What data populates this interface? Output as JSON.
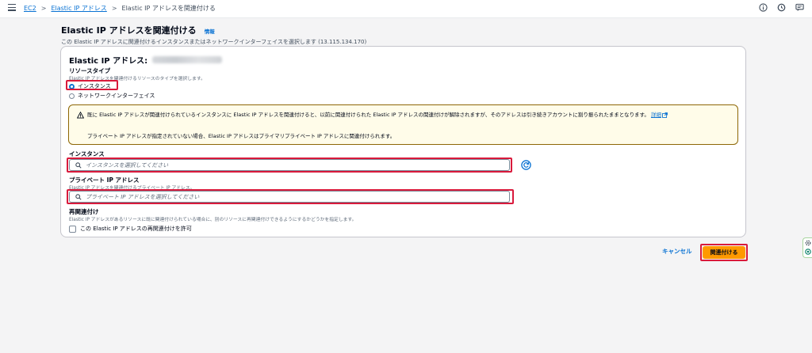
{
  "breadcrumb": {
    "items": [
      "EC2",
      "Elastic IP アドレス"
    ],
    "current": "Elastic IP アドレスを関連付ける"
  },
  "header": {
    "title": "Elastic IP アドレスを関連付ける",
    "info_link": "情報",
    "subtitle": "この Elastic IP アドレスに関連付けるインスタンスまたはネットワークインターフェイスを選択します (13.115.134.170)"
  },
  "panel": {
    "heading_prefix": "Elastic IP アドレス:",
    "resource_type": {
      "label": "リソースタイプ",
      "description": "Elastic IP アドレスを関連付けるリソースのタイプを選択します。",
      "options": [
        "インスタンス",
        "ネットワークインターフェイス"
      ],
      "selected": "インスタンス"
    },
    "warning": {
      "text": "既に Elastic IP アドレスが関連付けられているインスタンスに Elastic IP アドレスを関連付けると、以前に関連付けられた Elastic IP アドレスの関連付けが解除されますが、そのアドレスは引き続きアカウントに割り振られたままとなります。",
      "link": "詳細",
      "note": "プライベート IP アドレスが指定されていない場合、Elastic IP アドレスはプライマリプライベート IP アドレスに関連付けられます。"
    },
    "instance": {
      "label": "インスタンス",
      "placeholder": "インスタンスを選択してください"
    },
    "private_ip": {
      "label": "プライベート IP アドレス",
      "description": "Elastic IP アドレスを関連付けるプライベート IP アドレス。",
      "placeholder": "プライベート IP アドレスを選択してください"
    },
    "reassociation": {
      "label": "再関連付け",
      "description": "Elastic IP アドレスがあるリソースに既に関連付けられている場合に、別のリソースに再関連付けできるようにするかどうかを指定します。",
      "checkbox_label": "この Elastic IP アドレスの再関連付けを許可",
      "checked": false
    }
  },
  "actions": {
    "cancel": "キャンセル",
    "associate": "関連付ける"
  },
  "colors": {
    "link": "#0972d3",
    "primary_button": "#ff9900",
    "highlight": "#d91a3c",
    "warning_border": "#8d6605"
  }
}
